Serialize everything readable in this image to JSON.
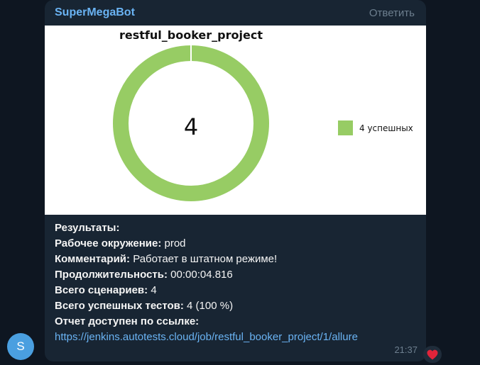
{
  "sender": {
    "name": "SuperMegaBot",
    "avatar_letter": "S",
    "avatar_color": "#4a9fe0"
  },
  "header": {
    "reply_label": "Ответить"
  },
  "report_image": {
    "chart_data": {
      "type": "pie",
      "title": "restful_booker_project",
      "center_label": "4",
      "slices": [
        {
          "name": "4 успешных",
          "value": 4,
          "color": "#97cc64"
        }
      ],
      "legend_position": "right"
    }
  },
  "message": {
    "results_label": "Результаты:",
    "env_label": "Рабочее окружение:",
    "env_value": "prod",
    "comment_label": "Комментарий:",
    "comment_value": "Работает в штатном режиме!",
    "duration_label": "Продолжительность:",
    "duration_value": "00:00:04.816",
    "scenarios_label": "Всего сценариев:",
    "scenarios_value": "4",
    "passed_label": "Всего успешных тестов:",
    "passed_value": "4 (100 %)",
    "report_label": "Отчет доступен по ссылке:",
    "report_link": "https://jenkins.autotests.cloud/job/restful_booker_project/1/allure"
  },
  "timestamp": "21:37",
  "reaction": {
    "icon": "red-heart-icon",
    "color": "#e0243a"
  }
}
